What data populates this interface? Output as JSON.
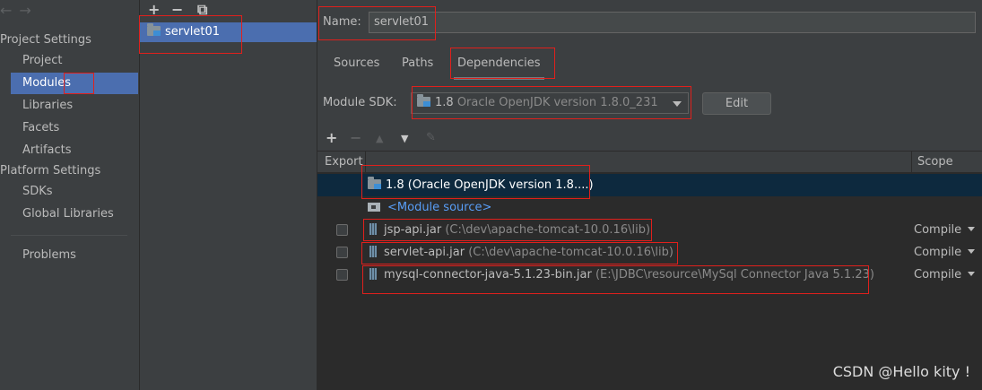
{
  "nav": {
    "back_glyph": "←",
    "forward_glyph": "→",
    "project_settings_header": "Project Settings",
    "project_items": [
      "Project",
      "Modules",
      "Libraries",
      "Facets",
      "Artifacts"
    ],
    "platform_settings_header": "Platform Settings",
    "platform_items": [
      "SDKs",
      "Global Libraries"
    ],
    "problems": "Problems",
    "selected": "Modules"
  },
  "modules": {
    "toolbar": [
      "+",
      "−",
      "⧉"
    ],
    "items": [
      "servlet01"
    ]
  },
  "main": {
    "name_label": "Name:",
    "name_value": "servlet01",
    "tabs": [
      "Sources",
      "Paths",
      "Dependencies"
    ],
    "selected_tab": "Dependencies",
    "sdk_label": "Module SDK:",
    "sdk_version": "1.8",
    "sdk_desc": "Oracle OpenJDK version 1.8.0_231",
    "edit_button": "Edit",
    "dep_toolbar": [
      "+",
      "−",
      "▲",
      "▼",
      "✎"
    ],
    "columns": {
      "export": "Export",
      "scope": "Scope"
    },
    "rows": [
      {
        "name": "1.8 (Oracle OpenJDK version 1.8....)"
      },
      {
        "name": "<Module source>"
      },
      {
        "name": "jsp-api.jar",
        "path": "(C:\\dev\\apache-tomcat-10.0.16\\lib)",
        "scope": "Compile"
      },
      {
        "name": "servlet-api.jar",
        "path": "(C:\\dev\\apache-tomcat-10.0.16\\lib)",
        "scope": "Compile"
      },
      {
        "name": "mysql-connector-java-5.1.23-bin.jar",
        "path": "(E:\\JDBC\\resource\\MySql Connector Java 5.1.23)",
        "scope": "Compile"
      }
    ]
  },
  "watermark": "CSDN @Hello kity !",
  "colors": {
    "selection": "#4b6eaf",
    "annotation": "#e0201c",
    "link": "#589df6"
  }
}
